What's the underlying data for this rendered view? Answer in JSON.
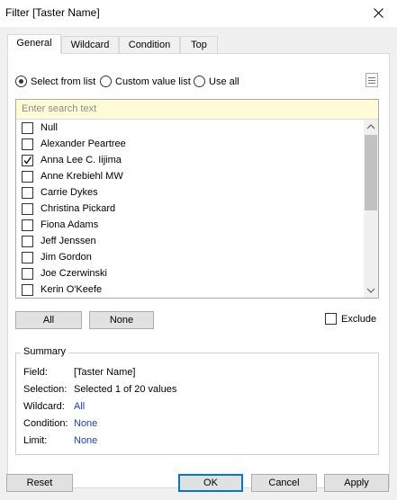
{
  "window": {
    "title": "Filter [Taster Name]"
  },
  "tabs": [
    {
      "label": "General",
      "active": true
    },
    {
      "label": "Wildcard",
      "active": false
    },
    {
      "label": "Condition",
      "active": false
    },
    {
      "label": "Top",
      "active": false
    }
  ],
  "mode": {
    "options": [
      "Select from list",
      "Custom value list",
      "Use all"
    ],
    "selected": "Select from list"
  },
  "search": {
    "placeholder": "Enter search text"
  },
  "list_items": [
    {
      "label": "Null",
      "checked": false
    },
    {
      "label": "Alexander Peartree",
      "checked": false
    },
    {
      "label": "Anna Lee C. Iijima",
      "checked": true
    },
    {
      "label": "Anne Krebiehl MW",
      "checked": false
    },
    {
      "label": "Carrie Dykes",
      "checked": false
    },
    {
      "label": "Christina Pickard",
      "checked": false
    },
    {
      "label": "Fiona Adams",
      "checked": false
    },
    {
      "label": "Jeff Jenssen",
      "checked": false
    },
    {
      "label": "Jim Gordon",
      "checked": false
    },
    {
      "label": "Joe Czerwinski",
      "checked": false
    },
    {
      "label": "Kerin O'Keefe",
      "checked": false
    }
  ],
  "selection_buttons": {
    "all": "All",
    "none": "None"
  },
  "exclude": {
    "label": "Exclude",
    "checked": false
  },
  "summary": {
    "heading": "Summary",
    "field": {
      "label": "Field:",
      "value": "[Taster Name]"
    },
    "selection": {
      "label": "Selection:",
      "value": "Selected 1 of 20 values"
    },
    "wildcard": {
      "label": "Wildcard:",
      "value": "All"
    },
    "condition": {
      "label": "Condition:",
      "value": "None"
    },
    "limit": {
      "label": "Limit:",
      "value": "None"
    }
  },
  "footer": {
    "reset": "Reset",
    "ok": "OK",
    "cancel": "Cancel",
    "apply": "Apply"
  },
  "colors": {
    "link_blue": "#1a3ec2",
    "search_bg": "#fffbd6",
    "default_button_border": "#0078d7"
  }
}
